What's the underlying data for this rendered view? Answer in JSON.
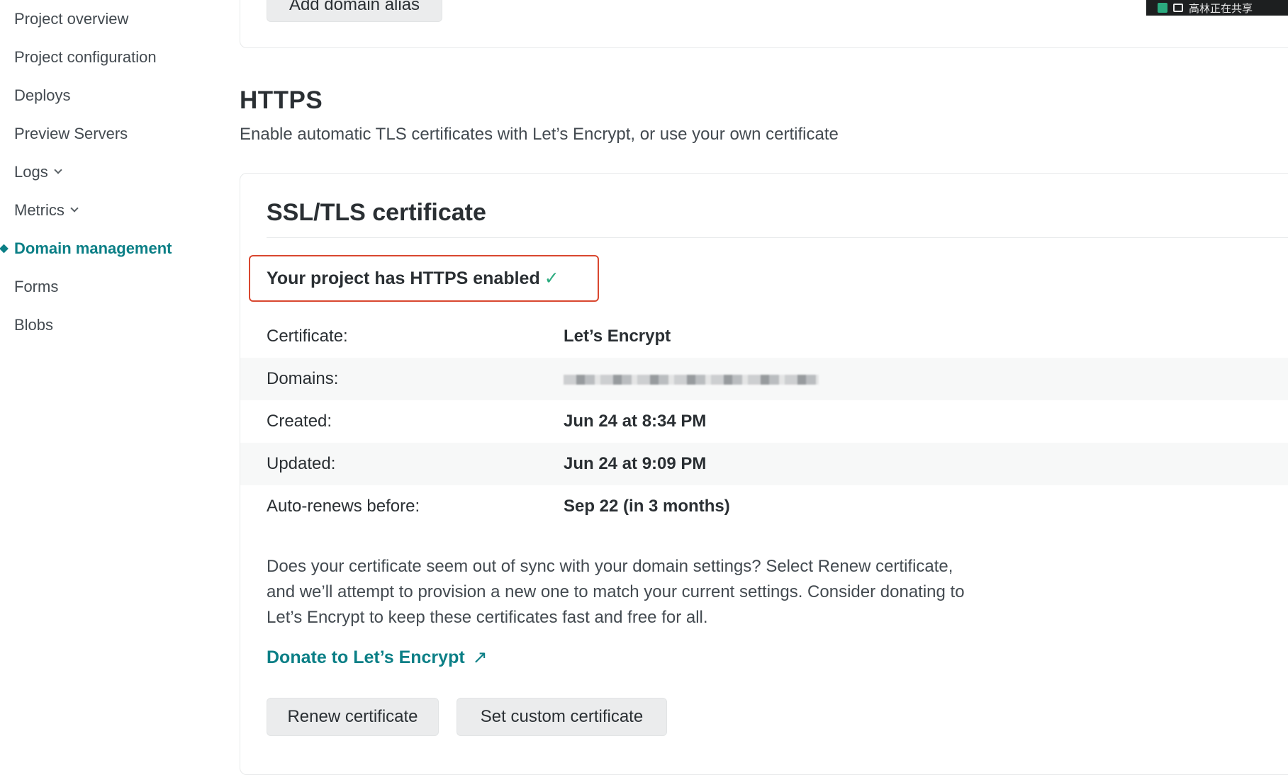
{
  "sidebar": {
    "items": [
      {
        "label": "Project overview"
      },
      {
        "label": "Project configuration"
      },
      {
        "label": "Deploys"
      },
      {
        "label": "Preview Servers"
      },
      {
        "label": "Logs"
      },
      {
        "label": "Metrics"
      },
      {
        "label": "Domain management"
      },
      {
        "label": "Forms"
      },
      {
        "label": "Blobs"
      }
    ],
    "active": "Domain management"
  },
  "top_card": {
    "add_alias_label": "Add domain alias"
  },
  "https": {
    "title": "HTTPS",
    "description": "Enable automatic TLS certificates with Let’s Encrypt, or use your own certificate"
  },
  "cert_card": {
    "title": "SSL/TLS certificate",
    "status": "Your project has HTTPS enabled",
    "status_check": "✓",
    "rows": [
      {
        "label": "Certificate:",
        "value": "Let’s Encrypt"
      },
      {
        "label": "Domains:",
        "value": ""
      },
      {
        "label": "Created:",
        "value": "Jun 24 at 8:34 PM"
      },
      {
        "label": "Updated:",
        "value": "Jun 24 at 9:09 PM"
      },
      {
        "label": "Auto-renews before:",
        "value": "Sep 22 (in 3 months)"
      }
    ],
    "help_text": "Does your certificate seem out of sync with your domain settings? Select Renew certificate, and we’ll attempt to provision a new one to match your current settings. Consider donating to Let’s Encrypt to keep these certificates fast and free for all.",
    "donate_label": "Donate to Let’s Encrypt",
    "donate_arrow": "↗",
    "renew_label": "Renew certificate",
    "custom_label": "Set custom certificate"
  },
  "share_overlay": {
    "text": "高林正在共享"
  },
  "colors": {
    "accent": "#0b7f86",
    "highlight_border": "#d9472f",
    "check": "#2bab7f"
  }
}
